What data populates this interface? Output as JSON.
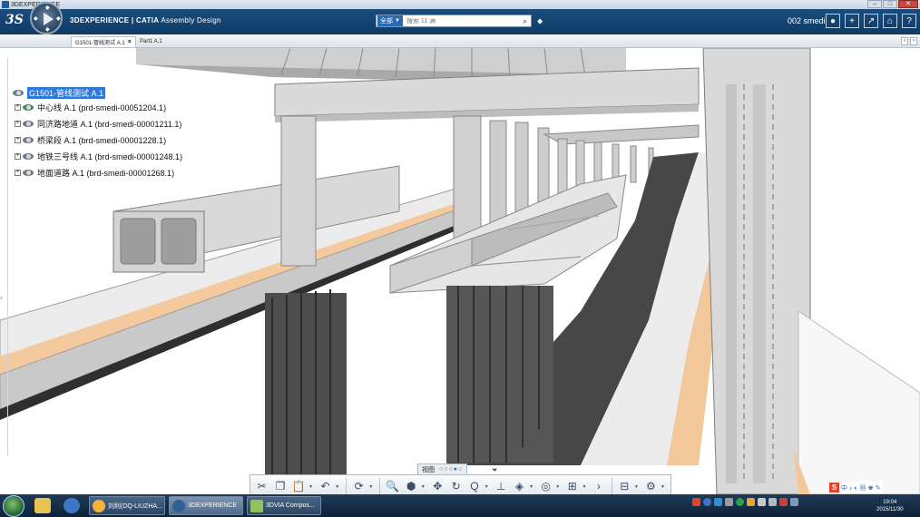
{
  "window": {
    "title": "3DEXPERIENCE"
  },
  "topbar": {
    "brand_prefix": "3DEXPERIENCE | ",
    "brand_app": "CATIA",
    "brand_suffix": " Assembly Design",
    "search_scope": "全部",
    "search_placeholder": "搜索 11 满",
    "user": "002 smedi"
  },
  "tabs": [
    {
      "label": "G1501-管线测试 A.1",
      "active": true
    },
    {
      "label": "Part1 A.1",
      "active": false
    }
  ],
  "tree": {
    "root": "G1501-管线测试 A.1",
    "items": [
      {
        "label": "中心线 A.1 (prd-smedi-00051204.1)"
      },
      {
        "label": "同济路地道 A.1 (brd-smedi-00001211.1)"
      },
      {
        "label": "桥梁段 A.1 (brd-smedi-00001228.1)"
      },
      {
        "label": "地铁三号线 A.1 (brd-smedi-00001248.1)"
      },
      {
        "label": "地面道路 A.1 (brd-smedi-00001268.1)"
      }
    ]
  },
  "action_bar": {
    "section_label": "视图",
    "section_count": 5,
    "section_active": 4
  },
  "taskbar": {
    "tasks": [
      {
        "label": "刘利(DQ-LIUZHA...",
        "active": false
      },
      {
        "label": "3DEXPERIENCE",
        "active": true
      },
      {
        "label": "3DVIA Compos...",
        "active": false
      }
    ],
    "time": "19:04",
    "date": "2015/11/30"
  },
  "colors": {
    "topbar": "#14456f",
    "selection": "#2f7ad8",
    "road_asphalt": "#4a4a4a",
    "road_shoulder": "#f2c89a",
    "concrete": "#d6d6d6"
  }
}
